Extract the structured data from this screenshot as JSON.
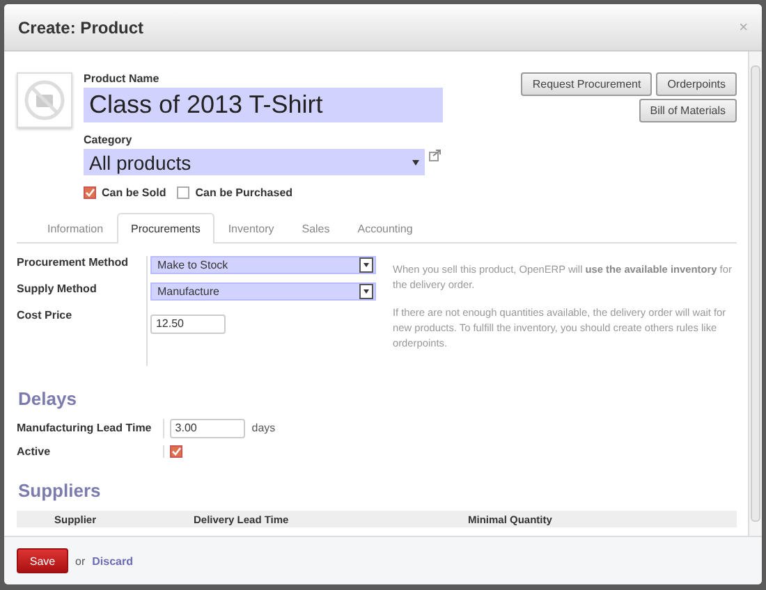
{
  "dialog": {
    "title": "Create: Product",
    "close": "×"
  },
  "product_name": {
    "label": "Product Name",
    "value": "Class of 2013 T-Shirt"
  },
  "category": {
    "label": "Category",
    "value": "All products"
  },
  "flags": [
    {
      "label": "Can be Sold",
      "checked": true
    },
    {
      "label": "Can be Purchased",
      "checked": false
    }
  ],
  "buttons": [
    [
      "Request Procurement",
      "Orderpoints"
    ],
    [
      "Bill of Materials"
    ]
  ],
  "tabs": [
    {
      "label": "Information",
      "selected": false
    },
    {
      "label": "Procurements",
      "selected": true
    },
    {
      "label": "Inventory",
      "selected": false
    },
    {
      "label": "Sales",
      "selected": false
    },
    {
      "label": "Accounting",
      "selected": false
    }
  ],
  "fields": [
    {
      "kind": "select",
      "label": "Procurement Method",
      "value": "Make to Stock"
    },
    {
      "kind": "select",
      "label": "Supply Method",
      "value": "Manufacture"
    },
    {
      "kind": "input",
      "label": "Cost Price",
      "value": "12.50"
    }
  ],
  "help": [
    "When you sell this product, OpenERP will **use the available inventory** for the delivery order.",
    "If there are not enough quantities available, the delivery order will wait for new products. To fulfill the inventory, you should create others rules like orderpoints."
  ],
  "delays": {
    "title": "Delays",
    "fields": [
      {
        "kind": "input",
        "label": "Manufacturing Lead Time",
        "value": "3.00",
        "unit": "days"
      },
      {
        "kind": "checkbox",
        "label": "Active",
        "checked": true
      }
    ]
  },
  "suppliers": {
    "title": "Suppliers",
    "columns": [
      "Supplier",
      "Delivery Lead Time",
      "Minimal Quantity"
    ]
  },
  "footer": {
    "save": "Save",
    "or": "or",
    "discard": "Discard"
  }
}
